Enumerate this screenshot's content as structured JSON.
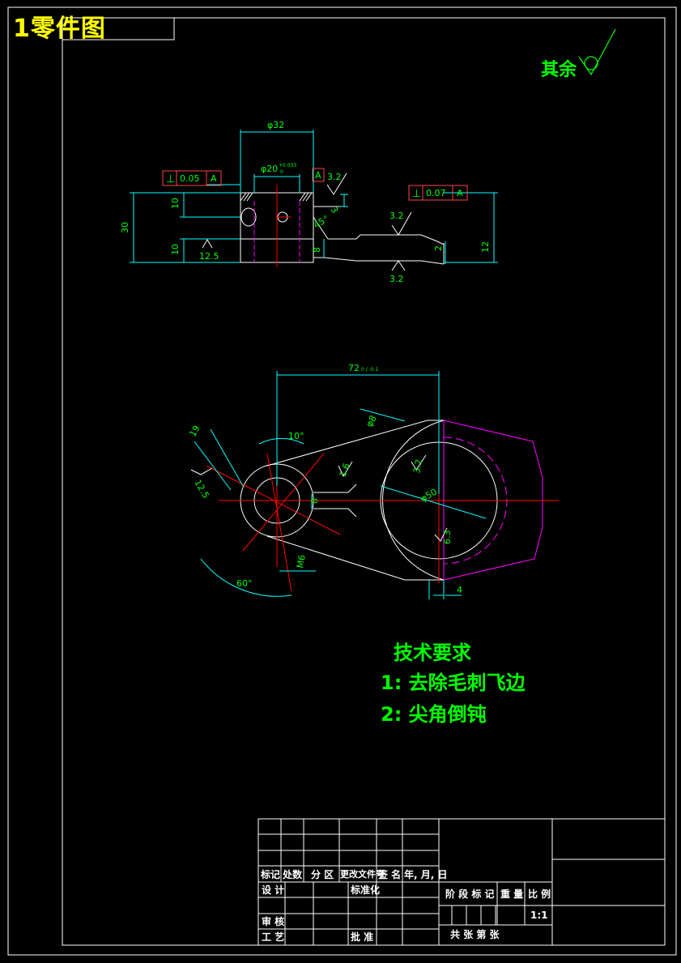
{
  "drawing": {
    "title": "1零件图",
    "rest_roughness_label": "其余",
    "section_view": {
      "dims": {
        "outer_diameter": "φ32",
        "bore_diameter": "φ20",
        "bore_tol_upper": "+0.033",
        "bore_tol_lower": "0",
        "height_total": "30",
        "height_upper": "10",
        "height_lower": "10",
        "arm_offset": "8",
        "slot_depth": "3",
        "chamfer": "45°",
        "step": "2",
        "right_height": "12"
      },
      "gdt": [
        {
          "symbol": "⊥",
          "value": "0.05",
          "datum": "A"
        },
        {
          "symbol": "⊥",
          "value": "0.07",
          "datum": "A"
        }
      ],
      "datum": "A",
      "roughness": [
        "3.2",
        "3.2",
        "3.2",
        "12.5"
      ]
    },
    "plan_view": {
      "dims": {
        "center_distance": "72",
        "center_distance_tol": "0 / -0.1",
        "angle_small": "10°",
        "angle_large": "60°",
        "width_19": "19",
        "width_8": "8",
        "radius_m6": "M6",
        "bore": "φ50",
        "hole_8": "φ8"
      },
      "roughness": [
        "12.5",
        "1.6",
        "3.2",
        "6.3"
      ],
      "offset_4": "4"
    }
  },
  "tech_requirements": {
    "title": "技术要求",
    "items": [
      "1: 去除毛刺飞边",
      "2: 尖角倒钝"
    ]
  },
  "title_block": {
    "row_mark": "标记",
    "row_count": "处数",
    "row_zone": "分 区",
    "row_doc": "更改文件号",
    "row_sign": "签 名",
    "row_date": "年, 月, 日",
    "design": "设 计",
    "standard": "标准化",
    "review": "审 核",
    "process": "工 艺",
    "approve": "批 准",
    "stage_mark": "阶 段 标 记",
    "weight": "重 量",
    "scale": "比 例",
    "scale_value": "1:1",
    "sheets": "共    张    第    张"
  }
}
